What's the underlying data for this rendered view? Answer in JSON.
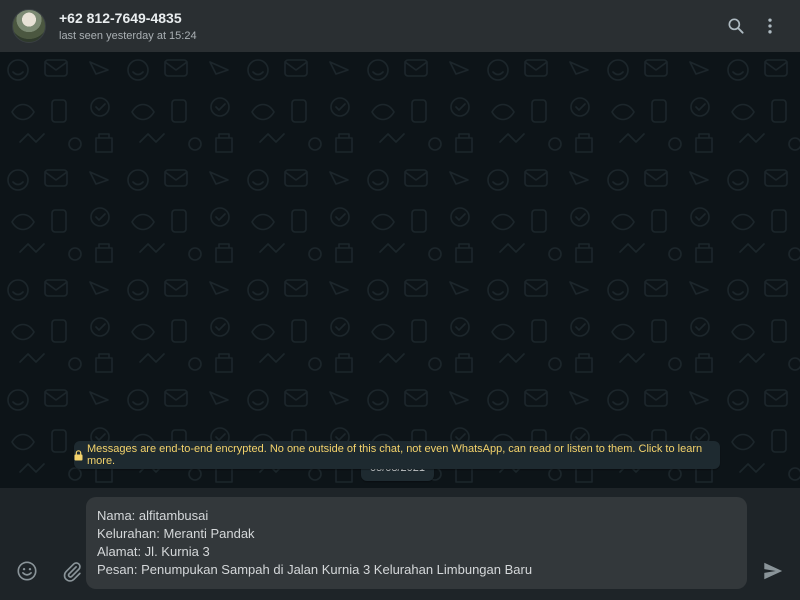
{
  "header": {
    "contact_name": "+62 812-7649-4835",
    "status": "last seen yesterday at 15:24",
    "icons": [
      "search-icon",
      "menu-dots-icon"
    ]
  },
  "chat": {
    "date_label": "05/08/2021",
    "encryption_notice": "Messages are end-to-end encrypted. No one outside of this chat, not even WhatsApp, can read or listen to them. Click to learn more."
  },
  "composer": {
    "lines": [
      "Nama: alfitambusai",
      "Kelurahan: Meranti Pandak",
      "Alamat: Jl. Kurnia 3",
      "Pesan: Penumpukan Sampah di Jalan Kurnia 3 Kelurahan Limbungan Baru"
    ]
  },
  "footer": {
    "icons": [
      "emoji-icon",
      "attach-icon",
      "send-icon"
    ]
  },
  "colors": {
    "header_bg": "#2a2f32",
    "chat_bg": "#0d1418",
    "notice_text": "#f4d36b",
    "composer_bg": "#33383b"
  }
}
